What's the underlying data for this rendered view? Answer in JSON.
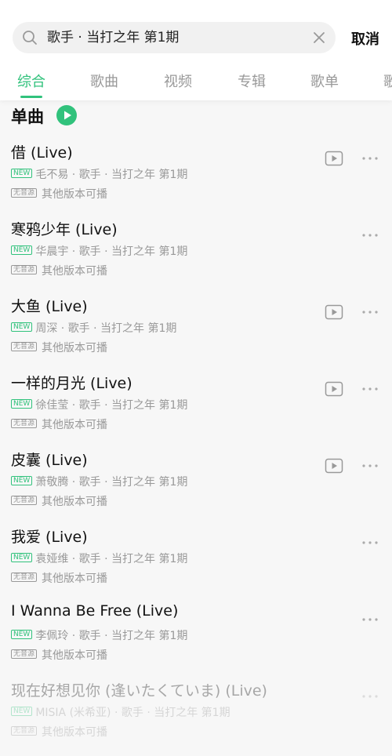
{
  "search": {
    "query": "歌手 · 当打之年 第1期",
    "cancel_label": "取消"
  },
  "tabs": [
    "综合",
    "歌曲",
    "视频",
    "专辑",
    "歌单",
    "歌"
  ],
  "section": {
    "title": "单曲"
  },
  "labels": {
    "new_badge": "NEW",
    "no_source_badge": "无音源",
    "other_versions": "其他版本可播",
    "separator": "·"
  },
  "songs": [
    {
      "title": "借 (Live)",
      "artist": "毛不易",
      "album": "歌手 · 当打之年 第1期",
      "has_mv": true
    },
    {
      "title": "寒鸦少年 (Live)",
      "artist": "华晨宇",
      "album": "歌手 · 当打之年 第1期",
      "has_mv": false
    },
    {
      "title": "大鱼 (Live)",
      "artist": "周深",
      "album": "歌手 · 当打之年 第1期",
      "has_mv": true
    },
    {
      "title": "一样的月光 (Live)",
      "artist": "徐佳莹",
      "album": "歌手 · 当打之年 第1期",
      "has_mv": true
    },
    {
      "title": "皮囊 (Live)",
      "artist": "萧敬腾",
      "album": "歌手 · 当打之年 第1期",
      "has_mv": true
    },
    {
      "title": "我爱 (Live)",
      "artist": "袁娅维",
      "album": "歌手 · 当打之年 第1期",
      "has_mv": false
    },
    {
      "title": "I Wanna Be Free (Live)",
      "artist": "李佩玲",
      "album": "歌手 · 当打之年 第1期",
      "has_mv": false
    },
    {
      "title": "现在好想见你 (逢いたくていま) (Live)",
      "artist": "MISIA (米希亚)",
      "album": "歌手 · 当打之年 第1期",
      "has_mv": false
    }
  ],
  "colors": {
    "accent": "#31c27c",
    "text": "#111111",
    "muted": "#999999",
    "background": "#f7f7f7"
  },
  "icons": {
    "search": "search-icon",
    "clear": "clear-icon",
    "play_all": "play-circle-icon",
    "mv": "mv-play-icon",
    "more": "more-dots-icon"
  }
}
